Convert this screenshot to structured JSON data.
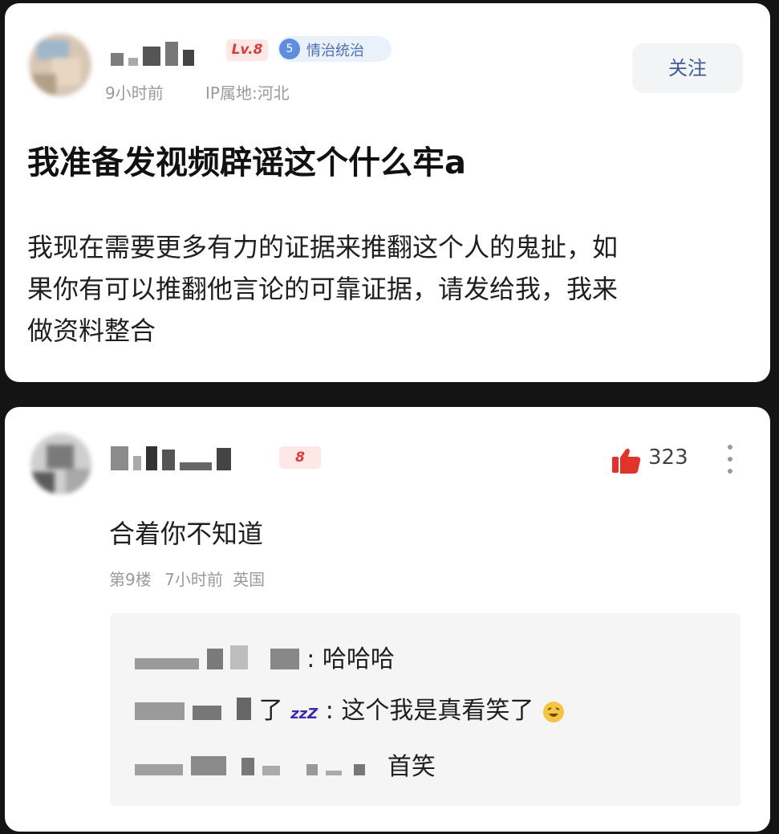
{
  "post": {
    "level_badge": "Lv.8",
    "vip_level": "5",
    "vip_label": "情治统治",
    "time": "9小时前",
    "ip_location": "IP属地:河北",
    "follow_label": "关注",
    "title": "我准备发视频辟谣这个什么牢a",
    "body_lines": [
      "我现在需要更多有力的证据来推翻这个人的鬼扯，如",
      "果你有可以推翻他言论的可靠证据，请发给我，我来",
      "做资料整合"
    ]
  },
  "comment": {
    "level_badge": "8",
    "like_count": "323",
    "text": "合着你不知道",
    "floor": "第9楼",
    "time": "7小时前",
    "location": "英国",
    "replies": [
      {
        "text": ": 哈哈哈"
      },
      {
        "name_suffix": "了",
        "zzz": "zzZ",
        "text": ": 这个我是真看笑了",
        "emoji": "laughing-emoji"
      },
      {
        "text": "首笑"
      }
    ]
  },
  "colors": {
    "background": "#141414",
    "card": "#ffffff",
    "level_red": "#d6403c",
    "vip_blue": "#5f8fdc",
    "like_red": "#e0332c",
    "follow_text": "#3d5c94"
  }
}
